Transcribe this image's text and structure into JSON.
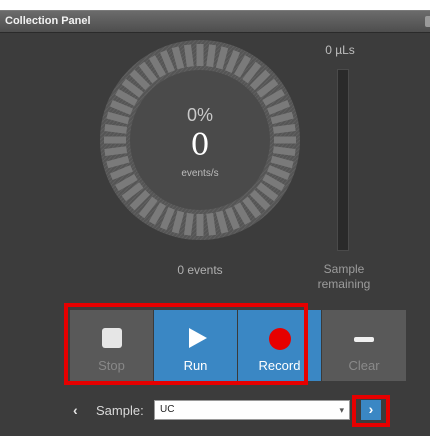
{
  "panel": {
    "title": "Collection Panel"
  },
  "gauge": {
    "percent": "0%",
    "rate": "0",
    "rate_unit": "events/s",
    "progress_fraction": 0
  },
  "sample_volume": {
    "value": "0 µLs",
    "remaining_label": "Sample remaining",
    "fill_fraction": 0
  },
  "events": {
    "count_label": "0 events"
  },
  "controls": {
    "stop_label": "Stop",
    "run_label": "Run",
    "record_label": "Record",
    "clear_label": "Clear"
  },
  "sample_selector": {
    "caption": "Sample:",
    "selected": "UC",
    "prev_glyph": "‹",
    "next_glyph": "›"
  },
  "colors": {
    "accent": "#3a87c4",
    "record": "#e60000",
    "highlight": "#e60000",
    "background": "#3c3c3c"
  }
}
